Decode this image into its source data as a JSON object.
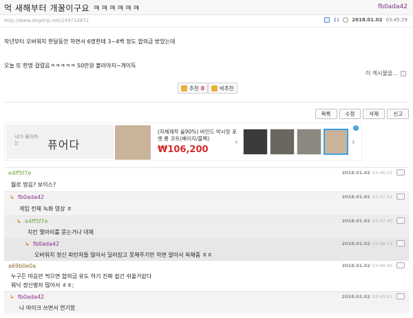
{
  "post": {
    "title": "억 새해부터 개꿀이구요 ㅋㅋㅋㅋㅋㅋ",
    "author": "fb0ada42",
    "url": "http://www.dogdrip.net/149710671",
    "views": "21",
    "date": "2018.01.02",
    "time": "03:45:29",
    "body_lines": [
      "작년부터 오버워치 한달동안 하면서 6명한테 3~4백 정도 합의금 받았는데",
      "오늘 또 한명 걸렸음ㅋㅋㅋㅋㅋ 50만원 불러야지~개이득"
    ],
    "more_label": "이 게시물을...",
    "upvote_label": "추천",
    "upvote_count": "0",
    "downvote_label": "비추천"
  },
  "buttons": [
    "목록",
    "수정",
    "삭제",
    "신고"
  ],
  "ad": {
    "logo_small": "내가 좋아하는",
    "logo_big": "퓨어다",
    "desc": "(자체제작 울90%) 바인드 박시핏 포켓 롱 코트(베이지/블랙)",
    "price": "₩106,200",
    "prev_arrow": "‹",
    "next_arrow": "›",
    "adchoice": "i"
  },
  "comments": [
    {
      "author": "e4ff5f7e",
      "text": "뭘로 땅음? 보이스?",
      "date": "2018.01.02",
      "time": "03:46:15",
      "depth": 0,
      "author_color": "#6fa83a"
    },
    {
      "author": "fb0ada42",
      "text": "게임 전체 녹화 영상 ㅎ",
      "date": "2018.01.02",
      "time": "03:47:22",
      "depth": 1,
      "author_color": "#8a2b8a"
    },
    {
      "author": "e4ff5f7e",
      "text": "치킨 몇마리를 뜯는거냐 대체",
      "date": "2018.01.02",
      "time": "03:47:40",
      "depth": 2,
      "author_color": "#6fa83a"
    },
    {
      "author": "fb0ada42",
      "text": "오버워치 정신 파탄자들 많아서 딜러잡고 못해주기만 하면 알아서 욕해줌 ㅎㅎ",
      "date": "2018.01.02",
      "time": "03:48:13",
      "depth": 3,
      "author_color": "#8a2b8a"
    },
    {
      "author": "a69b0e0a",
      "text": "누구든 마음만 먹으면 합의금 유도 하기 진짜 쉽긴 쉬울거같다",
      "text2": "뭐낙 정신병자 많아서 ㅎㅎ;",
      "date": "2018.01.02",
      "time": "03:48:49",
      "depth": 0,
      "author_color": "#8a6a2a"
    },
    {
      "author": "fb0ada42",
      "text": "나 마이크 쓰면서 연기함",
      "date": "2018.01.02",
      "time": "03:49:51",
      "depth": 1,
      "author_color": "#8a2b8a"
    }
  ],
  "colors": {
    "accent": "#8a2b8a",
    "price": "#d52a2a"
  }
}
